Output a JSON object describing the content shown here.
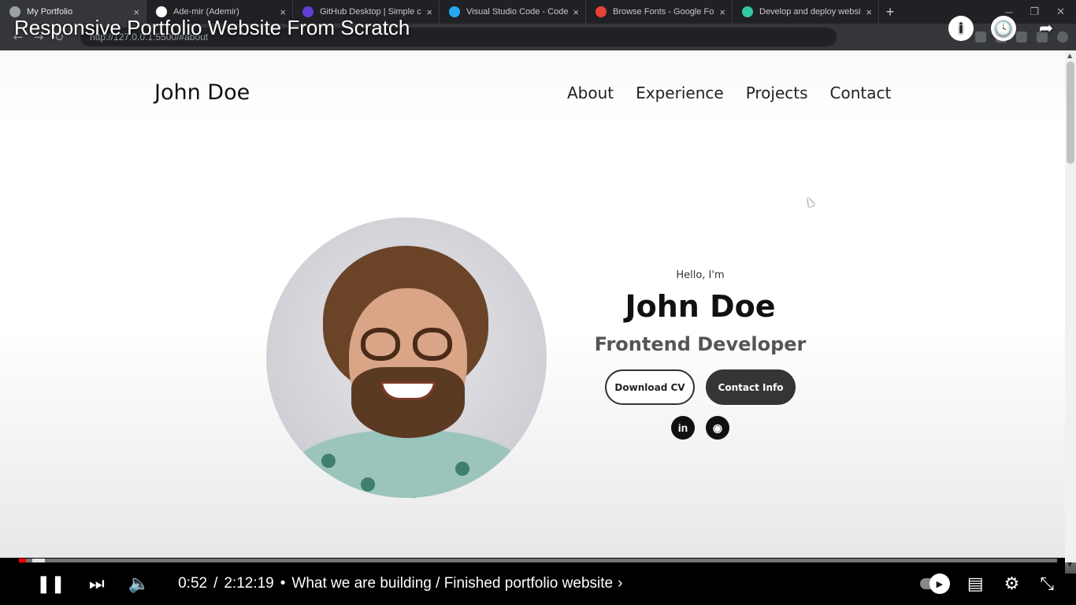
{
  "browser": {
    "tabs": [
      {
        "label": "My Portfolio",
        "active": true,
        "favicon_color": "#9aa0a6"
      },
      {
        "label": "Ade-mir (Ademir)",
        "active": false,
        "favicon_color": "#ffffff"
      },
      {
        "label": "GitHub Desktop | Simple co",
        "active": false,
        "favicon_color": "#5d3fd3"
      },
      {
        "label": "Visual Studio Code - Code I",
        "active": false,
        "favicon_color": "#23a9f2"
      },
      {
        "label": "Browse Fonts - Google Fon",
        "active": false,
        "favicon_color": "#ea4335"
      },
      {
        "label": "Develop and deploy websit",
        "active": false,
        "favicon_color": "#34c9a5"
      }
    ],
    "tab_close": "×",
    "new_tab": "+",
    "url": "http://127.0.0.1:5500/#about"
  },
  "video": {
    "title": "Responsive Portfolio Website From Scratch",
    "current_time": "0:52",
    "duration": "2:12:19",
    "chapter": "What we are building / Finished portfolio website",
    "chapter_separator": "•",
    "progress_fraction": 0.0066,
    "buffer_fraction": 0.012,
    "accent_color": "#ff0000"
  },
  "site": {
    "logo": "John Doe",
    "nav": [
      "About",
      "Experience",
      "Projects",
      "Contact"
    ],
    "hero": {
      "greeting": "Hello, I'm",
      "name": "John Doe",
      "role": "Frontend Developer",
      "buttons": {
        "download_cv": "Download CV",
        "contact_info": "Contact Info"
      },
      "socials": [
        {
          "name": "linkedin-icon",
          "glyph": "in"
        },
        {
          "name": "github-icon",
          "glyph": "◉"
        }
      ]
    }
  },
  "icons": {
    "info": "i",
    "watch_later": "🕓",
    "share": "➦",
    "pause": "❚❚",
    "next": "⏭",
    "volume": "🔈",
    "subtitles": "▤",
    "settings": "⚙",
    "exit_fullscreen": "⤡",
    "back": "←",
    "forward": "→",
    "reload": "↻"
  }
}
